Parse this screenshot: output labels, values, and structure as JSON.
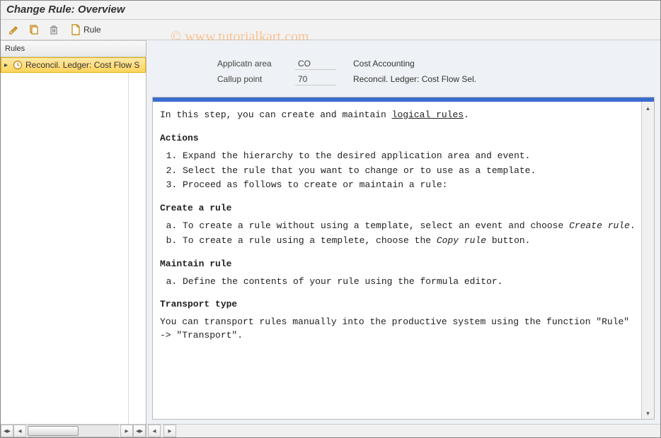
{
  "window": {
    "title": "Change Rule: Overview"
  },
  "watermark": "© www.tutorialkart.com",
  "toolbar": {
    "rule_label": "Rule"
  },
  "left": {
    "column_header": "Rules",
    "tree": {
      "node1_label": "Reconcil. Ledger: Cost Flow S"
    }
  },
  "header": {
    "row1": {
      "label": "Applicatn area",
      "code": "CO",
      "desc": "Cost Accounting"
    },
    "row2": {
      "label": "Callup point",
      "code": "70",
      "desc": "Reconcil. Ledger: Cost Flow Sel."
    }
  },
  "help": {
    "intro_pre": "In this step, you can create and maintain ",
    "intro_link": "logical rules",
    "intro_post": ".",
    "sec_actions": "Actions",
    "actions": [
      "Expand the hierarchy to the desired application area and event.",
      "Select the rule that you want to change or to use as a template.",
      "Proceed as follows to create or maintain a rule:"
    ],
    "sec_create": "Create a rule",
    "create_a_pre": "To create a rule without using a template, select an event and choose ",
    "create_a_em": "Create rule",
    "create_a_post": ".",
    "create_b_pre": "To create a rule using a templete, choose the ",
    "create_b_em": "Copy rule",
    "create_b_post": " button.",
    "sec_maintain": "Maintain rule",
    "maintain_a": "Define the contents of your rule using the formula editor.",
    "sec_transport": "Transport type",
    "transport_body": "You can transport rules manually into the productive system using the function \"Rule\" -> \"Transport\"."
  }
}
